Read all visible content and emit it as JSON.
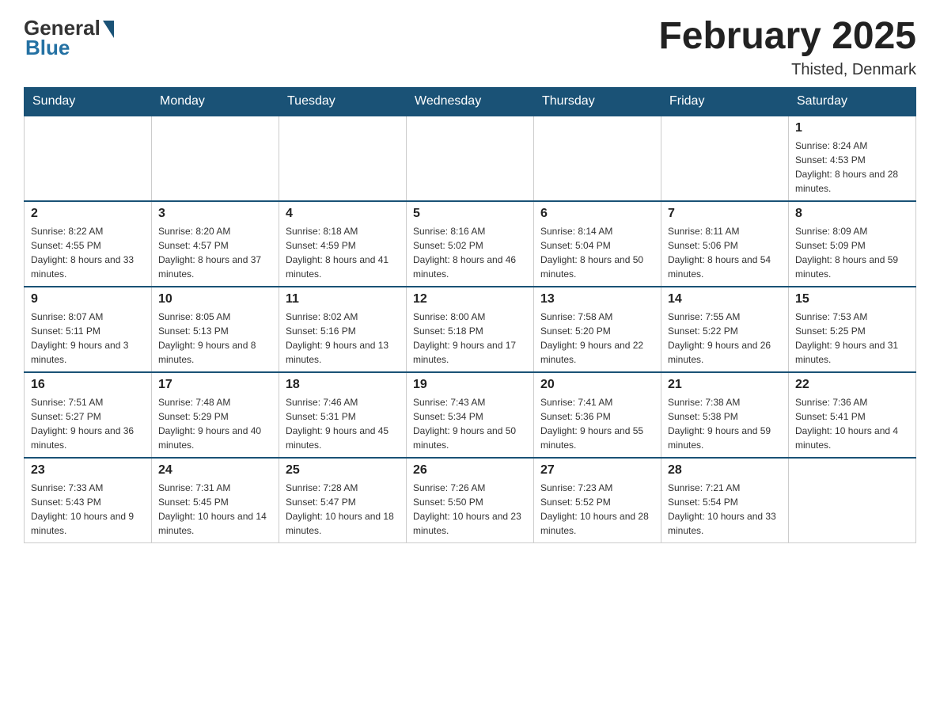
{
  "logo": {
    "general": "General",
    "blue": "Blue"
  },
  "title": "February 2025",
  "location": "Thisted, Denmark",
  "days_of_week": [
    "Sunday",
    "Monday",
    "Tuesday",
    "Wednesday",
    "Thursday",
    "Friday",
    "Saturday"
  ],
  "weeks": [
    [
      null,
      null,
      null,
      null,
      null,
      null,
      {
        "day": "1",
        "sunrise": "Sunrise: 8:24 AM",
        "sunset": "Sunset: 4:53 PM",
        "daylight": "Daylight: 8 hours and 28 minutes."
      }
    ],
    [
      {
        "day": "2",
        "sunrise": "Sunrise: 8:22 AM",
        "sunset": "Sunset: 4:55 PM",
        "daylight": "Daylight: 8 hours and 33 minutes."
      },
      {
        "day": "3",
        "sunrise": "Sunrise: 8:20 AM",
        "sunset": "Sunset: 4:57 PM",
        "daylight": "Daylight: 8 hours and 37 minutes."
      },
      {
        "day": "4",
        "sunrise": "Sunrise: 8:18 AM",
        "sunset": "Sunset: 4:59 PM",
        "daylight": "Daylight: 8 hours and 41 minutes."
      },
      {
        "day": "5",
        "sunrise": "Sunrise: 8:16 AM",
        "sunset": "Sunset: 5:02 PM",
        "daylight": "Daylight: 8 hours and 46 minutes."
      },
      {
        "day": "6",
        "sunrise": "Sunrise: 8:14 AM",
        "sunset": "Sunset: 5:04 PM",
        "daylight": "Daylight: 8 hours and 50 minutes."
      },
      {
        "day": "7",
        "sunrise": "Sunrise: 8:11 AM",
        "sunset": "Sunset: 5:06 PM",
        "daylight": "Daylight: 8 hours and 54 minutes."
      },
      {
        "day": "8",
        "sunrise": "Sunrise: 8:09 AM",
        "sunset": "Sunset: 5:09 PM",
        "daylight": "Daylight: 8 hours and 59 minutes."
      }
    ],
    [
      {
        "day": "9",
        "sunrise": "Sunrise: 8:07 AM",
        "sunset": "Sunset: 5:11 PM",
        "daylight": "Daylight: 9 hours and 3 minutes."
      },
      {
        "day": "10",
        "sunrise": "Sunrise: 8:05 AM",
        "sunset": "Sunset: 5:13 PM",
        "daylight": "Daylight: 9 hours and 8 minutes."
      },
      {
        "day": "11",
        "sunrise": "Sunrise: 8:02 AM",
        "sunset": "Sunset: 5:16 PM",
        "daylight": "Daylight: 9 hours and 13 minutes."
      },
      {
        "day": "12",
        "sunrise": "Sunrise: 8:00 AM",
        "sunset": "Sunset: 5:18 PM",
        "daylight": "Daylight: 9 hours and 17 minutes."
      },
      {
        "day": "13",
        "sunrise": "Sunrise: 7:58 AM",
        "sunset": "Sunset: 5:20 PM",
        "daylight": "Daylight: 9 hours and 22 minutes."
      },
      {
        "day": "14",
        "sunrise": "Sunrise: 7:55 AM",
        "sunset": "Sunset: 5:22 PM",
        "daylight": "Daylight: 9 hours and 26 minutes."
      },
      {
        "day": "15",
        "sunrise": "Sunrise: 7:53 AM",
        "sunset": "Sunset: 5:25 PM",
        "daylight": "Daylight: 9 hours and 31 minutes."
      }
    ],
    [
      {
        "day": "16",
        "sunrise": "Sunrise: 7:51 AM",
        "sunset": "Sunset: 5:27 PM",
        "daylight": "Daylight: 9 hours and 36 minutes."
      },
      {
        "day": "17",
        "sunrise": "Sunrise: 7:48 AM",
        "sunset": "Sunset: 5:29 PM",
        "daylight": "Daylight: 9 hours and 40 minutes."
      },
      {
        "day": "18",
        "sunrise": "Sunrise: 7:46 AM",
        "sunset": "Sunset: 5:31 PM",
        "daylight": "Daylight: 9 hours and 45 minutes."
      },
      {
        "day": "19",
        "sunrise": "Sunrise: 7:43 AM",
        "sunset": "Sunset: 5:34 PM",
        "daylight": "Daylight: 9 hours and 50 minutes."
      },
      {
        "day": "20",
        "sunrise": "Sunrise: 7:41 AM",
        "sunset": "Sunset: 5:36 PM",
        "daylight": "Daylight: 9 hours and 55 minutes."
      },
      {
        "day": "21",
        "sunrise": "Sunrise: 7:38 AM",
        "sunset": "Sunset: 5:38 PM",
        "daylight": "Daylight: 9 hours and 59 minutes."
      },
      {
        "day": "22",
        "sunrise": "Sunrise: 7:36 AM",
        "sunset": "Sunset: 5:41 PM",
        "daylight": "Daylight: 10 hours and 4 minutes."
      }
    ],
    [
      {
        "day": "23",
        "sunrise": "Sunrise: 7:33 AM",
        "sunset": "Sunset: 5:43 PM",
        "daylight": "Daylight: 10 hours and 9 minutes."
      },
      {
        "day": "24",
        "sunrise": "Sunrise: 7:31 AM",
        "sunset": "Sunset: 5:45 PM",
        "daylight": "Daylight: 10 hours and 14 minutes."
      },
      {
        "day": "25",
        "sunrise": "Sunrise: 7:28 AM",
        "sunset": "Sunset: 5:47 PM",
        "daylight": "Daylight: 10 hours and 18 minutes."
      },
      {
        "day": "26",
        "sunrise": "Sunrise: 7:26 AM",
        "sunset": "Sunset: 5:50 PM",
        "daylight": "Daylight: 10 hours and 23 minutes."
      },
      {
        "day": "27",
        "sunrise": "Sunrise: 7:23 AM",
        "sunset": "Sunset: 5:52 PM",
        "daylight": "Daylight: 10 hours and 28 minutes."
      },
      {
        "day": "28",
        "sunrise": "Sunrise: 7:21 AM",
        "sunset": "Sunset: 5:54 PM",
        "daylight": "Daylight: 10 hours and 33 minutes."
      },
      null
    ]
  ]
}
